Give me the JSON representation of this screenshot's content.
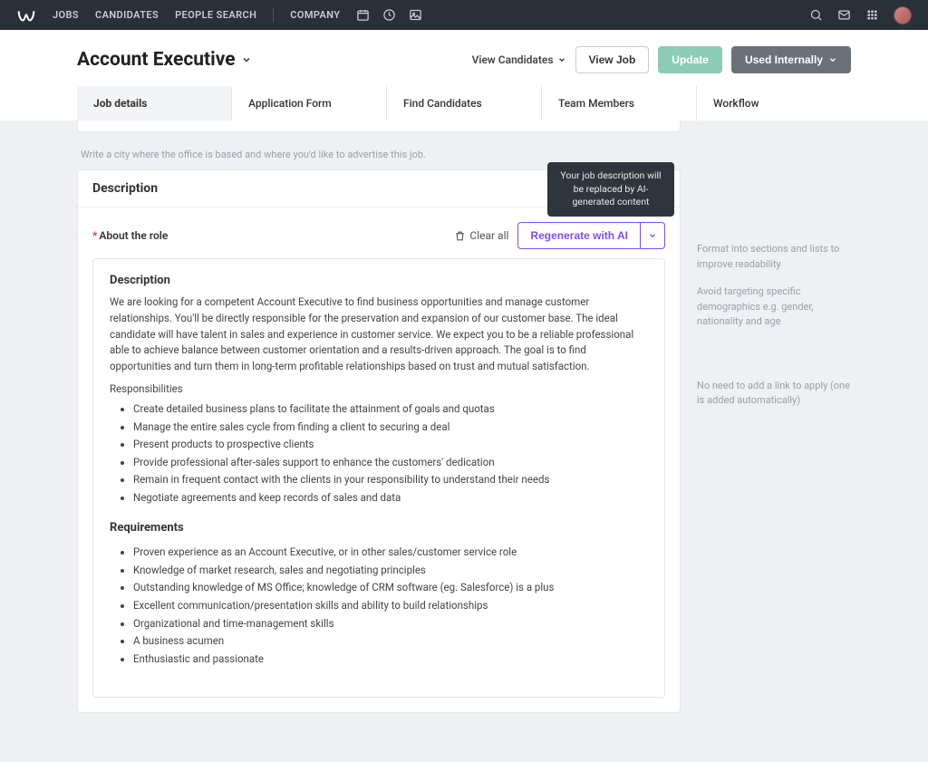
{
  "topnav": {
    "items": [
      "JOBS",
      "CANDIDATES",
      "PEOPLE SEARCH",
      "COMPANY"
    ]
  },
  "header": {
    "title": "Account Executive",
    "viewCandidates": "View Candidates",
    "viewJob": "View Job",
    "update": "Update",
    "usedInternally": "Used Internally"
  },
  "tabs": [
    "Job details",
    "Application Form",
    "Find Candidates",
    "Team Members",
    "Workflow"
  ],
  "cityHelp": "Write a city where the office is based and where you'd like to advertise this job.",
  "section": {
    "title": "Description",
    "aboutLabel": "About the role",
    "clearAll": "Clear all",
    "regenerate": "Regenerate with AI",
    "tooltip": "Your job description will be replaced by AI-generated content"
  },
  "sideTips": [
    "Format into sections and lists to improve readability",
    "Avoid targeting specific demographics e.g. gender, nationality and age",
    "No need to add a link to apply (one is added automatically)"
  ],
  "description": {
    "heading": "Description",
    "intro": "We are looking for a competent Account Executive to find business opportunities and manage customer relationships. You'll be directly responsible for the preservation and expansion of our customer base. The ideal candidate will have talent in sales and experience in customer service. We expect you to be a reliable professional able to achieve balance between customer orientation and a results-driven approach. The goal is to find opportunities and turn them in long-term profitable relationships based on trust and mutual satisfaction.",
    "respHead": "Responsibilities",
    "responsibilities": [
      "Create detailed business plans to facilitate the attainment of goals and quotas",
      "Manage the entire sales cycle from finding a client to securing a deal",
      "Present products to prospective clients",
      "Provide professional after-sales support to enhance the customers' dedication",
      "Remain in frequent contact with the clients in your responsibility to understand their needs",
      "Negotiate agreements and keep records of sales and data"
    ],
    "reqHead": "Requirements",
    "requirements": [
      "Proven experience as an Account Executive, or in other sales/customer service role",
      "Knowledge of market research, sales and negotiating principles",
      "Outstanding knowledge of MS Office; knowledge of CRM software (eg. Salesforce) is a plus",
      "Excellent communication/presentation skills and ability to build relationships",
      "Organizational and time-management skills",
      "A business acumen",
      "Enthusiastic and passionate"
    ]
  }
}
